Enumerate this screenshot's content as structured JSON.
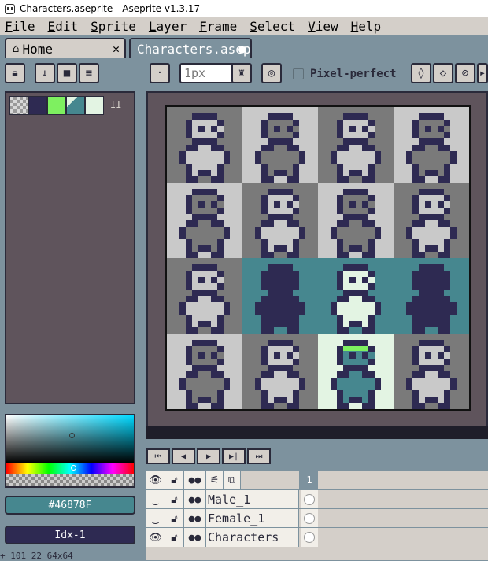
{
  "window": {
    "title": "Characters.aseprite - Aseprite v1.3.17"
  },
  "menu": [
    {
      "label": "File",
      "u": "F",
      "rest": "ile"
    },
    {
      "label": "Edit",
      "u": "E",
      "rest": "dit"
    },
    {
      "label": "Sprite",
      "u": "S",
      "rest": "prite"
    },
    {
      "label": "Layer",
      "u": "L",
      "rest": "ayer"
    },
    {
      "label": "Frame",
      "u": "F",
      "rest": "rame"
    },
    {
      "label": "Select",
      "u": "S",
      "rest": "elect"
    },
    {
      "label": "View",
      "u": "V",
      "rest": "iew"
    },
    {
      "label": "Help",
      "u": "H",
      "rest": "elp"
    }
  ],
  "tabs": [
    {
      "label": "Home",
      "icon": "home-icon",
      "close": "✕"
    },
    {
      "label": "Characters.asep",
      "icon": "",
      "close": "●"
    }
  ],
  "brush": {
    "size_placeholder": "1px",
    "pixel_perfect_label": "Pixel-perfect"
  },
  "palette": {
    "colors": [
      "#7a7a7a",
      "#2e2a52",
      "#7ef060",
      "#46878f",
      "#e3f4e3"
    ],
    "more": "II"
  },
  "color": {
    "hex_label": "#46878F",
    "index_label": "Idx-1",
    "fg": "#46878f",
    "bg": "#2e2a52"
  },
  "timeline": {
    "frame_header": "1",
    "layers": [
      {
        "name": "Male_1",
        "visible": false
      },
      {
        "name": "Female_1",
        "visible": false
      },
      {
        "name": "Characters",
        "visible": true
      }
    ]
  },
  "status": {
    "text": "+ 101 22   64x64"
  }
}
